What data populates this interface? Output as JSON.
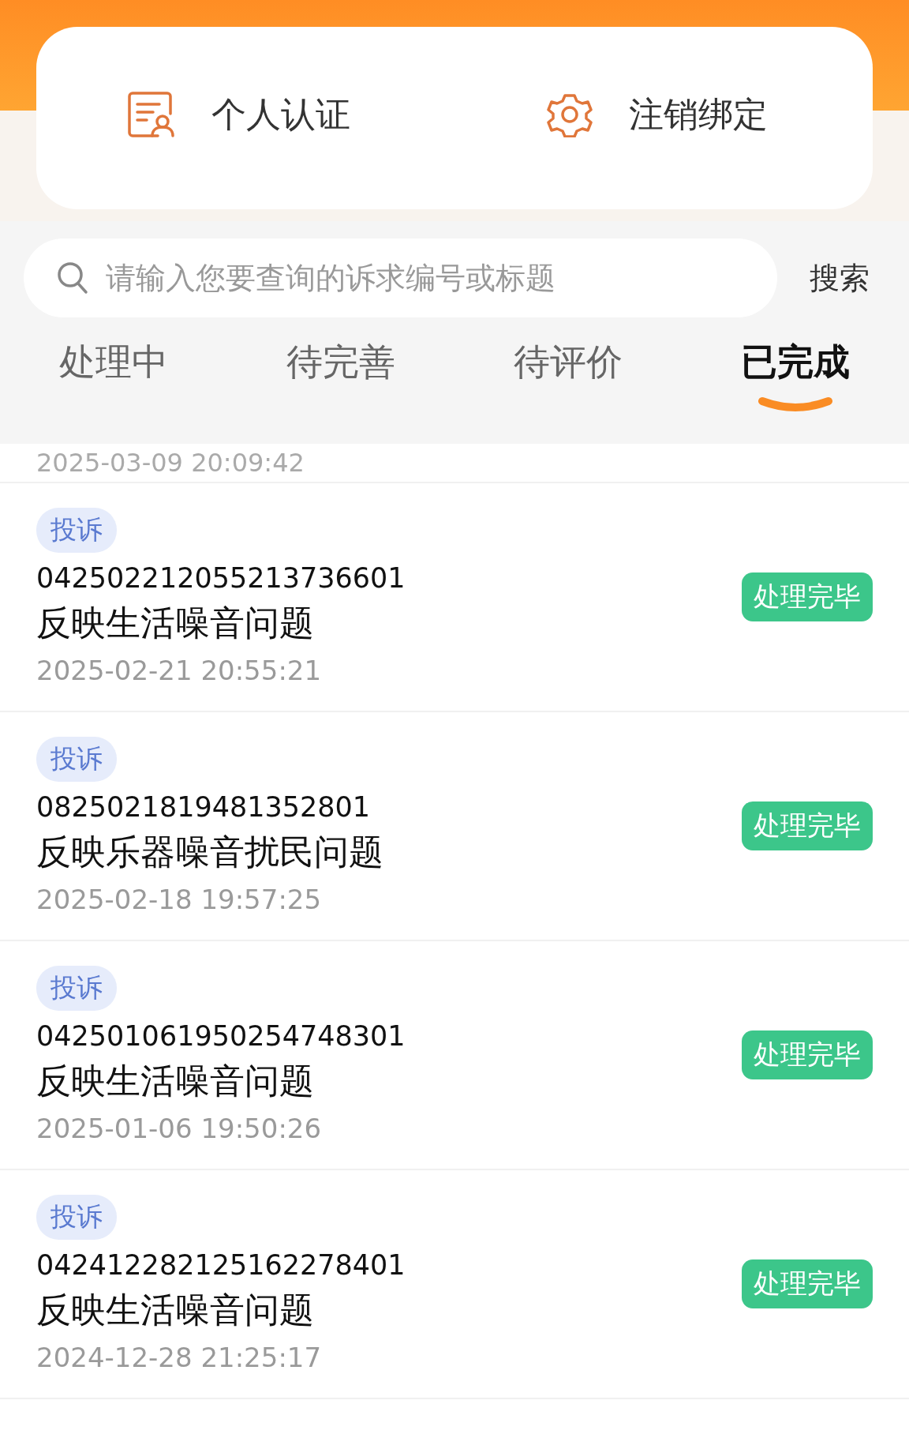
{
  "actions": [
    {
      "kind": "certify",
      "label": "个人认证"
    },
    {
      "kind": "unbind",
      "label": "注销绑定"
    }
  ],
  "search": {
    "placeholder": "请输入您要查询的诉求编号或标题",
    "button": "搜索"
  },
  "tabs": [
    {
      "label": "处理中",
      "selected": false
    },
    {
      "label": "待完善",
      "selected": false
    },
    {
      "label": "待评价",
      "selected": false
    },
    {
      "label": "已完成",
      "selected": true
    }
  ],
  "partial_row": {
    "date": "2025-03-09 20:09:42"
  },
  "records": [
    {
      "tag": "投诉",
      "number": "042502212055213736601",
      "title": "反映生活噪音问题",
      "date": "2025-02-21 20:55:21",
      "status": "处理完毕"
    },
    {
      "tag": "投诉",
      "number": "0825021819481352801",
      "title": "反映乐器噪音扰民问题",
      "date": "2025-02-18 19:57:25",
      "status": "处理完毕"
    },
    {
      "tag": "投诉",
      "number": "042501061950254748301",
      "title": "反映生活噪音问题",
      "date": "2025-01-06 19:50:26",
      "status": "处理完毕"
    },
    {
      "tag": "投诉",
      "number": "042412282125162278401",
      "title": "反映生活噪音问题",
      "date": "2024-12-28 21:25:17",
      "status": "处理完毕"
    }
  ]
}
